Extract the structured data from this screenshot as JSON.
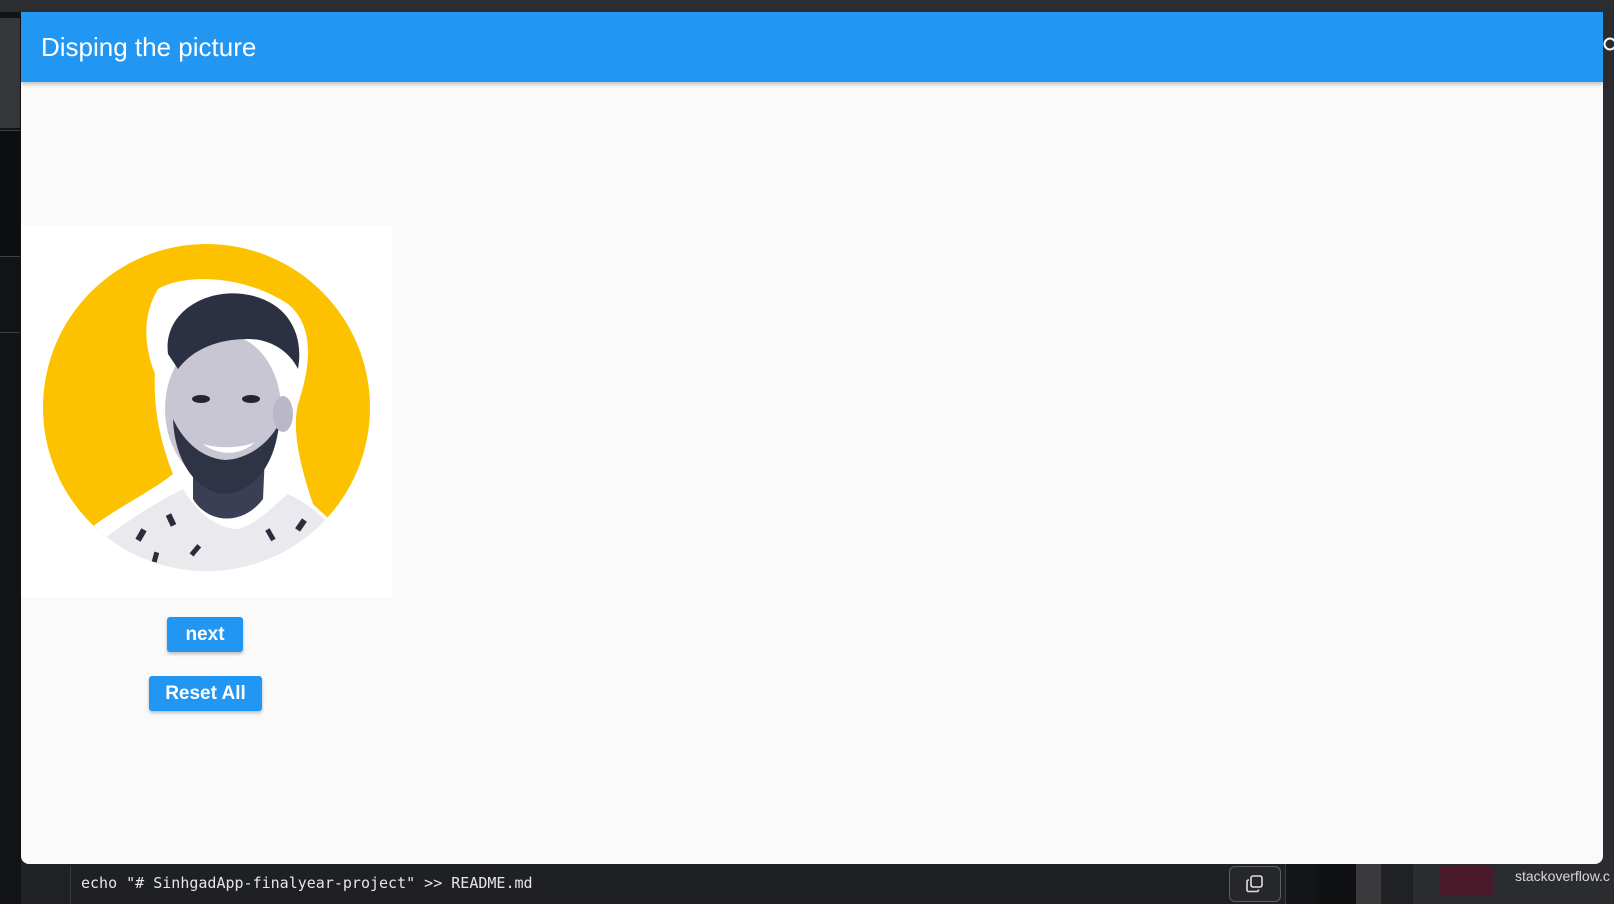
{
  "app": {
    "title": "Disping the picture",
    "buttons": {
      "next_label": "next",
      "reset_label": "Reset All"
    },
    "colors": {
      "primary": "#2196f3",
      "avatar_background": "#fcc200"
    }
  },
  "background": {
    "code_line": "echo \"# SinhgadApp-finalyear-project\" >> README.md",
    "link_text": "stackoverflow.c"
  },
  "icons": {
    "search": "search-icon",
    "copy": "copy-icon",
    "profile": "profile-photo"
  }
}
